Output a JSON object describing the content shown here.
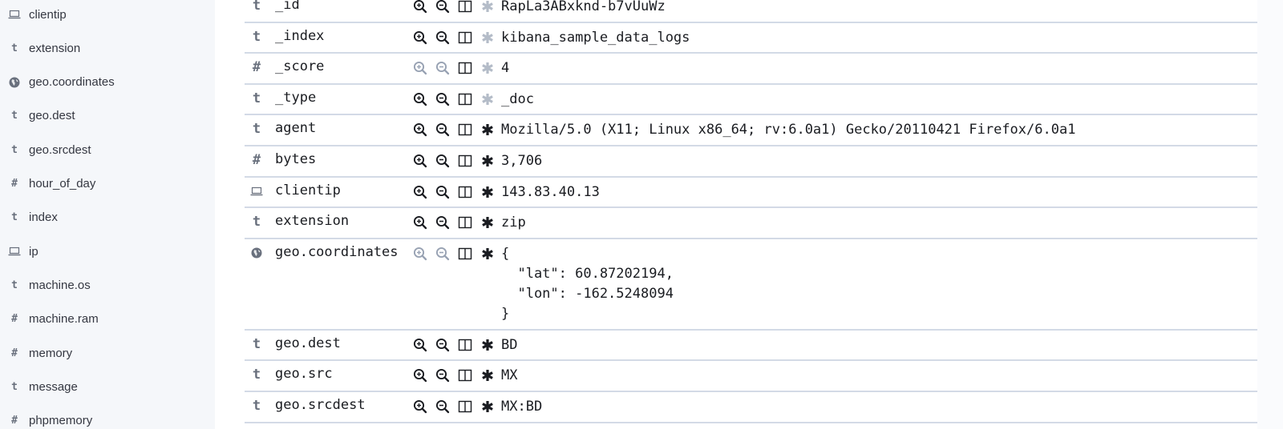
{
  "sidebar": {
    "items": [
      {
        "type": "ip",
        "label": "clientip"
      },
      {
        "type": "string",
        "label": "extension"
      },
      {
        "type": "geo",
        "label": "geo.coordinates"
      },
      {
        "type": "string",
        "label": "geo.dest"
      },
      {
        "type": "string",
        "label": "geo.srcdest"
      },
      {
        "type": "number",
        "label": "hour_of_day"
      },
      {
        "type": "string",
        "label": "index"
      },
      {
        "type": "ip",
        "label": "ip"
      },
      {
        "type": "string",
        "label": "machine.os"
      },
      {
        "type": "number",
        "label": "machine.ram"
      },
      {
        "type": "number",
        "label": "memory"
      },
      {
        "type": "string",
        "label": "message"
      },
      {
        "type": "number",
        "label": "phpmemory"
      }
    ]
  },
  "type_glyphs": {
    "string": "t",
    "number": "#"
  },
  "doc_table": {
    "actions": {
      "filter_for": "filter-for-value",
      "filter_out": "filter-out-value",
      "toggle_column": "toggle-column",
      "filter_exists": "filter-for-field-present"
    },
    "rows": [
      {
        "type": "string",
        "field": "_id",
        "value": "RapLa3ABxknd-b7vUuWz",
        "filters_enabled": true,
        "exists_enabled": false
      },
      {
        "type": "string",
        "field": "_index",
        "value": "kibana_sample_data_logs",
        "filters_enabled": true,
        "exists_enabled": false
      },
      {
        "type": "number",
        "field": "_score",
        "value": "4",
        "filters_enabled": false,
        "exists_enabled": false
      },
      {
        "type": "string",
        "field": "_type",
        "value": "_doc",
        "filters_enabled": true,
        "exists_enabled": false
      },
      {
        "type": "string",
        "field": "agent",
        "value": "Mozilla/5.0 (X11; Linux x86_64; rv:6.0a1) Gecko/20110421 Firefox/6.0a1",
        "filters_enabled": true,
        "exists_enabled": true
      },
      {
        "type": "number",
        "field": "bytes",
        "value": "3,706",
        "filters_enabled": true,
        "exists_enabled": true
      },
      {
        "type": "ip",
        "field": "clientip",
        "value": "143.83.40.13",
        "filters_enabled": true,
        "exists_enabled": true
      },
      {
        "type": "string",
        "field": "extension",
        "value": "zip",
        "filters_enabled": true,
        "exists_enabled": true
      },
      {
        "type": "geo",
        "field": "geo.coordinates",
        "value": "{\n  \"lat\": 60.87202194,\n  \"lon\": -162.5248094\n}",
        "filters_enabled": false,
        "exists_enabled": true
      },
      {
        "type": "string",
        "field": "geo.dest",
        "value": "BD",
        "filters_enabled": true,
        "exists_enabled": true
      },
      {
        "type": "string",
        "field": "geo.src",
        "value": "MX",
        "filters_enabled": true,
        "exists_enabled": true
      },
      {
        "type": "string",
        "field": "geo.srcdest",
        "value": "MX:BD",
        "filters_enabled": true,
        "exists_enabled": true
      }
    ]
  },
  "colors": {
    "icon_enabled": "#1a1c21",
    "icon_disabled": "#98a2b3",
    "exists_disabled": "#b4bcc8",
    "type_icon": "#69707d",
    "row_border": "#d3dae6",
    "sidebar_bg": "#f5f7fa"
  }
}
